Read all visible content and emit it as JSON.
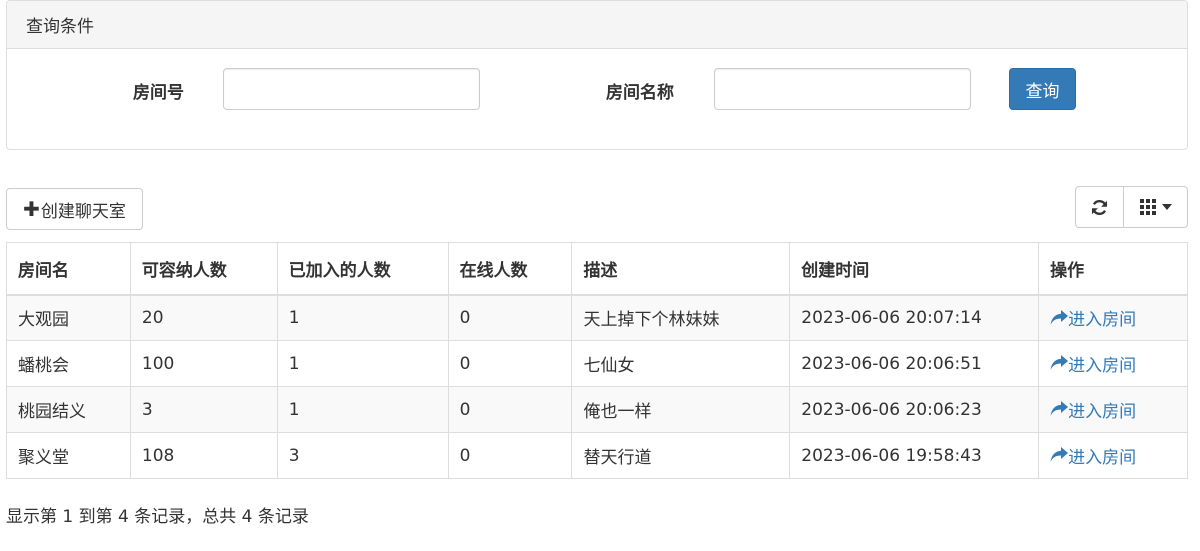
{
  "query_panel": {
    "title": "查询条件",
    "room_no_label": "房间号",
    "room_no_value": "",
    "room_name_label": "房间名称",
    "room_name_value": "",
    "search_label": "查询"
  },
  "toolbar": {
    "create_label": "创建聊天室",
    "refresh_icon": "refresh-icon",
    "columns_icon": "grid-icon"
  },
  "table": {
    "headers": [
      "房间名",
      "可容纳人数",
      "已加入的人数",
      "在线人数",
      "描述",
      "创建时间",
      "操作"
    ],
    "rows": [
      {
        "name": "大观园",
        "capacity": "20",
        "joined": "1",
        "online": "0",
        "desc": "天上掉下个林妹妹",
        "created": "2023-06-06 20:07:14",
        "action": "进入房间"
      },
      {
        "name": "蟠桃会",
        "capacity": "100",
        "joined": "1",
        "online": "0",
        "desc": "七仙女",
        "created": "2023-06-06 20:06:51",
        "action": "进入房间"
      },
      {
        "name": "桃园结义",
        "capacity": "3",
        "joined": "1",
        "online": "0",
        "desc": "俺也一样",
        "created": "2023-06-06 20:06:23",
        "action": "进入房间"
      },
      {
        "name": "聚义堂",
        "capacity": "108",
        "joined": "3",
        "online": "0",
        "desc": "替天行道",
        "created": "2023-06-06 19:58:43",
        "action": "进入房间"
      }
    ]
  },
  "pagination": {
    "info": "显示第 1 到第 4 条记录，总共 4 条记录"
  },
  "colors": {
    "primary": "#337ab7",
    "border": "#dddddd",
    "stripe": "#f9f9f9"
  }
}
